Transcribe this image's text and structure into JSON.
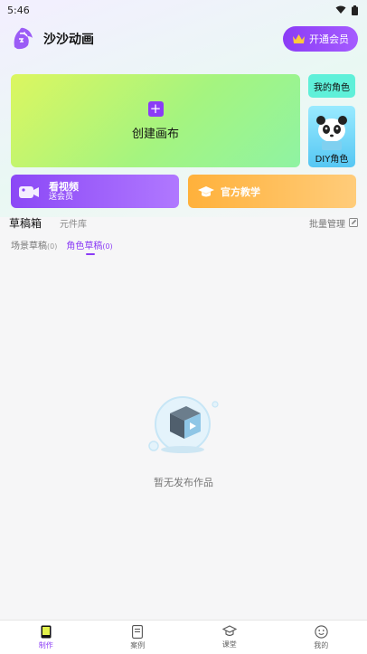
{
  "status_bar": {
    "time": "5:46"
  },
  "header": {
    "app_name": "沙沙动画",
    "vip_label": "开通会员"
  },
  "cards": {
    "create": "创建画布",
    "my_role": "我的角色",
    "diy_role": "DIY角色",
    "video_title": "看视频",
    "video_sub": "送会员",
    "tutorial": "官方教学"
  },
  "tabs": {
    "drafts": "草稿箱",
    "components": "元件库",
    "batch": "批量管理"
  },
  "sub_tabs": [
    {
      "label": "场景草稿",
      "count": "(0)"
    },
    {
      "label": "角色草稿",
      "count": "(0)"
    }
  ],
  "empty_text": "暂无发布作品",
  "bottom_nav": [
    {
      "label": "制作"
    },
    {
      "label": "案例"
    },
    {
      "label": "课堂"
    },
    {
      "label": "我的"
    }
  ],
  "colors": {
    "accent": "#8b3cf6"
  }
}
